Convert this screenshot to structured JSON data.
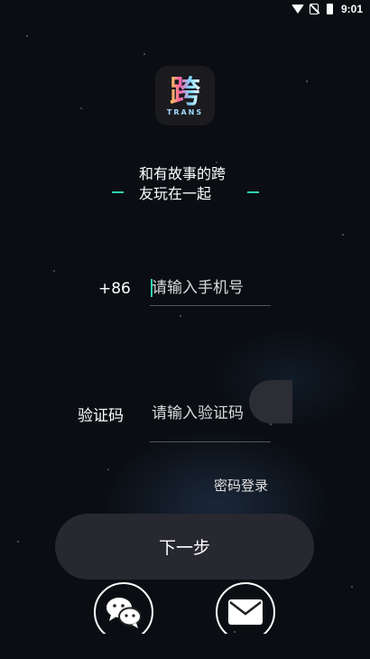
{
  "status_bar": {
    "time": "9:01"
  },
  "logo": {
    "char": "跨",
    "word": "TRANS"
  },
  "slogan": "和有故事的跨友玩在一起",
  "phone": {
    "country_code": "+86",
    "placeholder": "请输入手机号"
  },
  "code": {
    "label": "验证码",
    "placeholder": "请输入验证码"
  },
  "password_login_label": "密码登录",
  "next_button_label": "下一步",
  "icons": {
    "wechat": "wechat-icon",
    "mail": "mail-icon"
  },
  "colors": {
    "accent": "#31d0b2",
    "button_bg": "#272830"
  }
}
